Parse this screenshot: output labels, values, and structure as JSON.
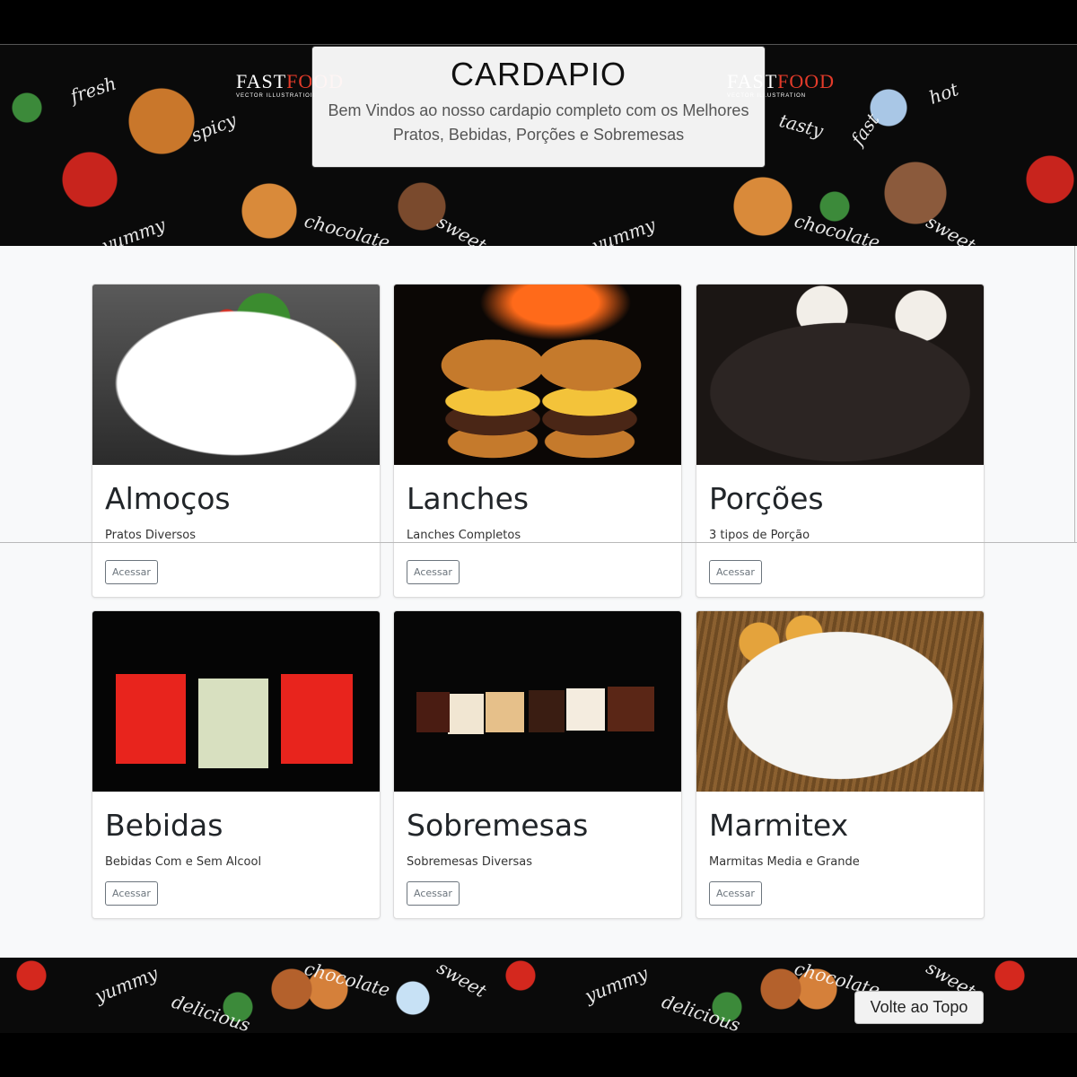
{
  "header": {
    "title": "CARDAPIO",
    "subtitle": "Bem Vindos ao nosso cardapio completo com os Melhores Pratos, Bebidas, Porções e Sobremesas",
    "brand_left": "FAST",
    "brand_right": "FOOD",
    "brand_small": "VECTOR ILLUSTRATION",
    "deco_words": [
      "fresh",
      "spicy",
      "tasty",
      "hot",
      "fast",
      "yummy",
      "chocolate",
      "sweet"
    ]
  },
  "cards": [
    {
      "title": "Almoços",
      "subtitle": "Pratos Diversos",
      "button": "Acessar",
      "image": "grilled-chicken-plate"
    },
    {
      "title": "Lanches",
      "subtitle": "Lanches Completos",
      "button": "Acessar",
      "image": "burgers"
    },
    {
      "title": "Porções",
      "subtitle": "3 tipos de Porção",
      "button": "Acessar",
      "image": "meat-and-fries-skillet"
    },
    {
      "title": "Bebidas",
      "subtitle": "Bebidas Com e Sem Alcool",
      "button": "Acessar",
      "image": "cocktails"
    },
    {
      "title": "Sobremesas",
      "subtitle": "Sobremesas Diversas",
      "button": "Acessar",
      "image": "cake-slices"
    },
    {
      "title": "Marmitex",
      "subtitle": "Marmitas Media e Grande",
      "button": "Acessar",
      "image": "rice-and-steak-box"
    }
  ],
  "footer": {
    "back_to_top": "Volte ao Topo",
    "deco_words": [
      "yummy",
      "delicious",
      "chocolate",
      "sweet"
    ]
  },
  "colors": {
    "page_background": "#f8f9fa",
    "banner_background": "#0a0a0a",
    "button_border": "#6c757d",
    "title_text": "#212529"
  }
}
